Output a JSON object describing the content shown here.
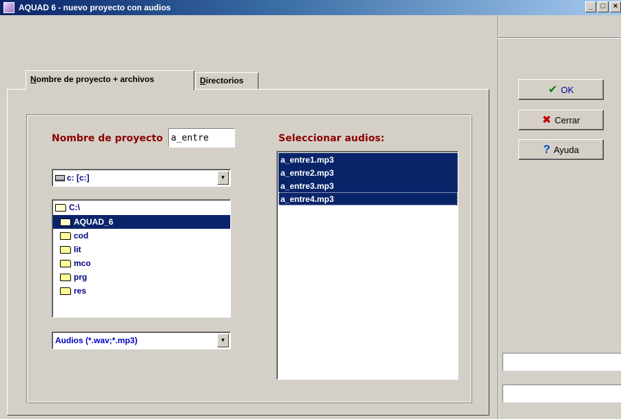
{
  "window": {
    "title": "AQUAD 6 - nuevo proyecto con audios",
    "minimize_label": "_",
    "maximize_label": "□",
    "close_label": "×"
  },
  "tabs": [
    {
      "label_mnemonic": "N",
      "label_rest": "ombre de proyecto + archivos",
      "active": true
    },
    {
      "label_mnemonic": "D",
      "label_rest": "irectorios",
      "active": false
    }
  ],
  "form": {
    "project_name_label": "Nombre de proyecto",
    "project_name_value": "a_entre",
    "drive_value": "c: [c:]",
    "filter_value": "Audios (*.wav;*.mp3)",
    "select_audios_label": "Seleccionar audios:"
  },
  "directories": [
    {
      "name": "C:\\",
      "icon": "folder-open-icon",
      "selected": false,
      "indent": 0
    },
    {
      "name": "AQUAD_6",
      "icon": "folder-open-icon",
      "selected": true,
      "indent": 1
    },
    {
      "name": "cod",
      "icon": "folder-icon",
      "selected": false,
      "indent": 1
    },
    {
      "name": "lit",
      "icon": "folder-icon",
      "selected": false,
      "indent": 1
    },
    {
      "name": "mco",
      "icon": "folder-icon",
      "selected": false,
      "indent": 1
    },
    {
      "name": "prg",
      "icon": "folder-icon",
      "selected": false,
      "indent": 1
    },
    {
      "name": "res",
      "icon": "folder-icon",
      "selected": false,
      "indent": 1
    }
  ],
  "audios": [
    {
      "name": "a_entre1.mp3",
      "selected": true
    },
    {
      "name": "a_entre2.mp3",
      "selected": true
    },
    {
      "name": "a_entre3.mp3",
      "selected": true
    },
    {
      "name": "a_entre4.mp3",
      "selected": true,
      "focused": true
    }
  ],
  "buttons": {
    "ok": {
      "label": "OK",
      "icon": "check-icon",
      "icon_color": "#008000"
    },
    "close": {
      "label": "Cerrar",
      "icon": "x-icon",
      "icon_color": "#c00000"
    },
    "help": {
      "label": "Ayuda",
      "icon": "question-icon",
      "icon_color": "#0050c0"
    }
  },
  "colors": {
    "label_red": "#8b0000",
    "selection": "#0a246a",
    "window_bg": "#d4d0c8"
  }
}
